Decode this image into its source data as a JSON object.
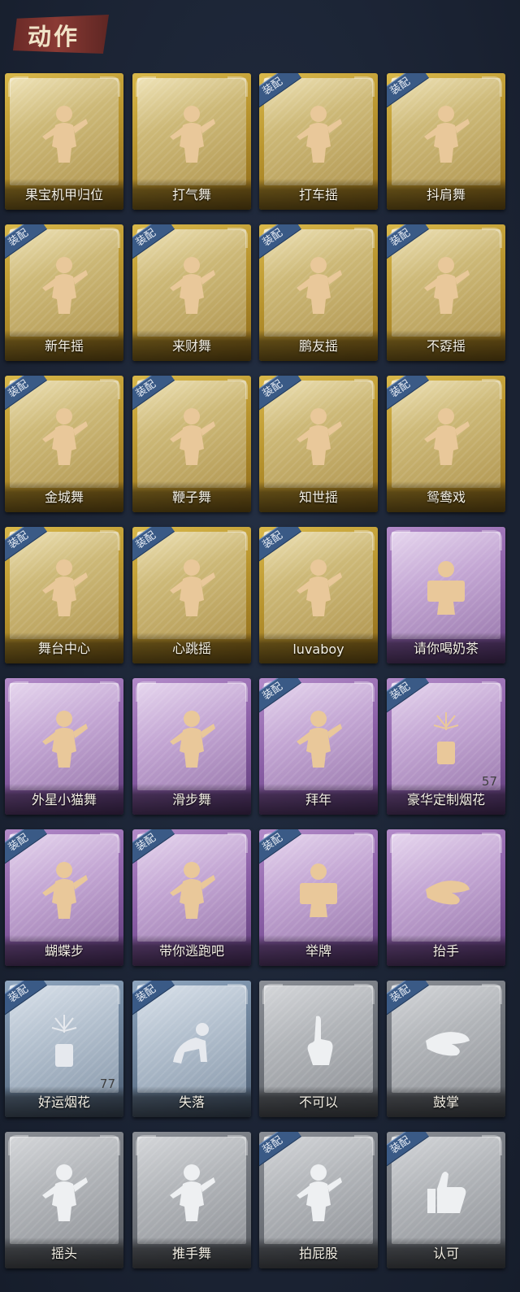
{
  "section": {
    "title": "动作"
  },
  "equip_label": "装配",
  "items": [
    {
      "label": "果宝机甲归位",
      "rarity": "gold",
      "equipped": false,
      "count": "",
      "icon": "figure-icon"
    },
    {
      "label": "打气舞",
      "rarity": "gold",
      "equipped": false,
      "count": "",
      "icon": "figure-icon"
    },
    {
      "label": "打车摇",
      "rarity": "gold",
      "equipped": true,
      "count": "",
      "icon": "figure-icon"
    },
    {
      "label": "抖肩舞",
      "rarity": "gold",
      "equipped": true,
      "count": "",
      "icon": "figure-icon"
    },
    {
      "label": "新年摇",
      "rarity": "gold",
      "equipped": true,
      "count": "",
      "icon": "figure-icon"
    },
    {
      "label": "来财舞",
      "rarity": "gold",
      "equipped": true,
      "count": "",
      "icon": "figure-icon"
    },
    {
      "label": "鹏友摇",
      "rarity": "gold",
      "equipped": true,
      "count": "",
      "icon": "figure-icon"
    },
    {
      "label": "不孬摇",
      "rarity": "gold",
      "equipped": true,
      "count": "",
      "icon": "figure-icon"
    },
    {
      "label": "金城舞",
      "rarity": "gold",
      "equipped": true,
      "count": "",
      "icon": "figure-icon"
    },
    {
      "label": "鞭子舞",
      "rarity": "gold",
      "equipped": true,
      "count": "",
      "icon": "figure-icon"
    },
    {
      "label": "知世摇",
      "rarity": "gold",
      "equipped": true,
      "count": "",
      "icon": "figure-icon"
    },
    {
      "label": "鸳鸯戏",
      "rarity": "gold",
      "equipped": true,
      "count": "",
      "icon": "figure-icon"
    },
    {
      "label": "舞台中心",
      "rarity": "gold",
      "equipped": true,
      "count": "",
      "icon": "figure-icon"
    },
    {
      "label": "心跳摇",
      "rarity": "gold",
      "equipped": true,
      "count": "",
      "icon": "figure-icon"
    },
    {
      "label": "luvaboy",
      "rarity": "gold",
      "equipped": true,
      "count": "",
      "icon": "figure-icon"
    },
    {
      "label": "请你喝奶茶",
      "rarity": "purple",
      "equipped": false,
      "count": "",
      "icon": "sign-figure-icon"
    },
    {
      "label": "外星小猫舞",
      "rarity": "purple",
      "equipped": false,
      "count": "",
      "icon": "figure-icon"
    },
    {
      "label": "滑步舞",
      "rarity": "purple",
      "equipped": false,
      "count": "",
      "icon": "figure-icon"
    },
    {
      "label": "拜年",
      "rarity": "purple",
      "equipped": true,
      "count": "",
      "icon": "figure-icon"
    },
    {
      "label": "豪华定制烟花",
      "rarity": "purple",
      "equipped": true,
      "count": "57",
      "icon": "fireworks-icon"
    },
    {
      "label": "蝴蝶步",
      "rarity": "purple",
      "equipped": true,
      "count": "",
      "icon": "figure-icon"
    },
    {
      "label": "带你逃跑吧",
      "rarity": "purple",
      "equipped": true,
      "count": "",
      "icon": "figure-icon"
    },
    {
      "label": "举牌",
      "rarity": "purple",
      "equipped": true,
      "count": "",
      "icon": "sign-figure-icon"
    },
    {
      "label": "抬手",
      "rarity": "purple",
      "equipped": false,
      "count": "",
      "icon": "hand-icon"
    },
    {
      "label": "好运烟花",
      "rarity": "blue",
      "equipped": true,
      "count": "77",
      "icon": "fireworks-icon"
    },
    {
      "label": "失落",
      "rarity": "blue",
      "equipped": true,
      "count": "",
      "icon": "crawl-figure-icon"
    },
    {
      "label": "不可以",
      "rarity": "grey",
      "equipped": false,
      "count": "",
      "icon": "finger-icon"
    },
    {
      "label": "鼓掌",
      "rarity": "grey",
      "equipped": true,
      "count": "",
      "icon": "clap-icon"
    },
    {
      "label": "摇头",
      "rarity": "grey",
      "equipped": false,
      "count": "",
      "icon": "figure-icon"
    },
    {
      "label": "推手舞",
      "rarity": "grey",
      "equipped": false,
      "count": "",
      "icon": "figure-icon"
    },
    {
      "label": "拍屁股",
      "rarity": "grey",
      "equipped": true,
      "count": "",
      "icon": "figure-icon"
    },
    {
      "label": "认可",
      "rarity": "grey",
      "equipped": true,
      "count": "",
      "icon": "thumbs-up-icon"
    }
  ]
}
